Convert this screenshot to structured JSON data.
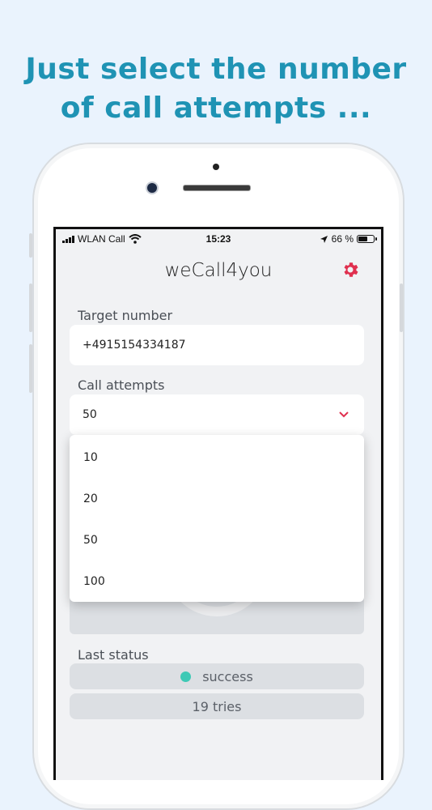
{
  "headline": {
    "line1": "Just select the number",
    "line2": "of call attempts ..."
  },
  "statusbar": {
    "carrier": "WLAN Call",
    "time": "15:23",
    "battery": "66 %",
    "battery_level": 0.66,
    "icons": [
      "signal-bars-icon",
      "wifi-icon",
      "location-arrow-icon",
      "battery-icon"
    ]
  },
  "app": {
    "title": "weCall4you",
    "settings_icon": "gear-icon",
    "accent": "#e0304e",
    "target_label": "Target number",
    "target_value": "+4915154334187",
    "attempts_label": "Call attempts",
    "attempts_value": "50",
    "attempts_options": [
      "10",
      "20",
      "50",
      "100"
    ],
    "last_status_label": "Last status",
    "status_text": "success",
    "status_color": "#3ec9b5",
    "tries_text": "19 tries"
  },
  "colors": {
    "background": "#eaf3fd",
    "headline": "#1f93b4"
  }
}
